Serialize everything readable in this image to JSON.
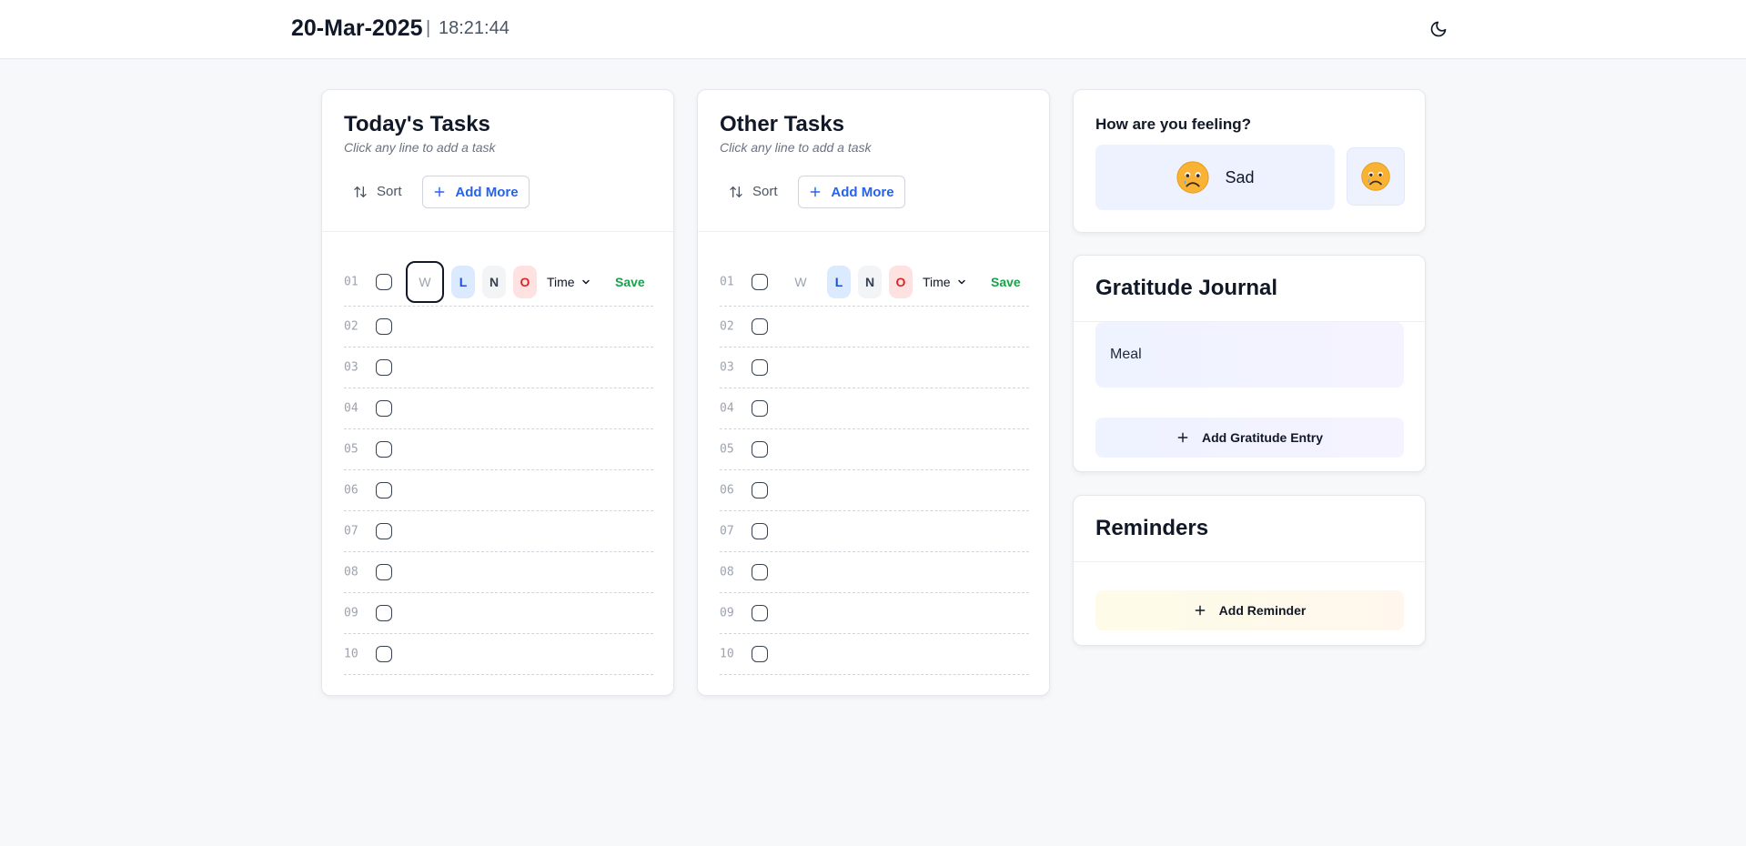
{
  "header": {
    "date": "20-Mar-2025",
    "separator": "|",
    "time": "18:21:44",
    "theme_icon": "moon-icon"
  },
  "today_tasks": {
    "title": "Today's Tasks",
    "subtitle": "Click any line to add a task",
    "sort_label": "Sort",
    "add_more_label": "Add More",
    "rows": [
      "01",
      "02",
      "03",
      "04",
      "05",
      "06",
      "07",
      "08",
      "09",
      "10"
    ],
    "editor": {
      "w_placeholder": "W",
      "l": "L",
      "n": "N",
      "o": "O",
      "time_label": "Time",
      "save_label": "Save"
    }
  },
  "other_tasks": {
    "title": "Other Tasks",
    "subtitle": "Click any line to add a task",
    "sort_label": "Sort",
    "add_more_label": "Add More",
    "rows": [
      "01",
      "02",
      "03",
      "04",
      "05",
      "06",
      "07",
      "08",
      "09",
      "10"
    ],
    "editor": {
      "w_placeholder": "W",
      "l": "L",
      "n": "N",
      "o": "O",
      "time_label": "Time",
      "save_label": "Save"
    }
  },
  "mood": {
    "title": "How are you feeling?",
    "selected_label": "Sad",
    "selected_icon": "sad-face-icon"
  },
  "gratitude": {
    "title": "Gratitude Journal",
    "entries": [
      "Meal"
    ],
    "add_label": "Add Gratitude Entry"
  },
  "reminders": {
    "title": "Reminders",
    "add_label": "Add Reminder"
  },
  "colors": {
    "accent_blue": "#2563eb",
    "save_green": "#16a34a",
    "priority_low_bg": "#dbeafe",
    "priority_high_bg": "#fee2e2"
  }
}
